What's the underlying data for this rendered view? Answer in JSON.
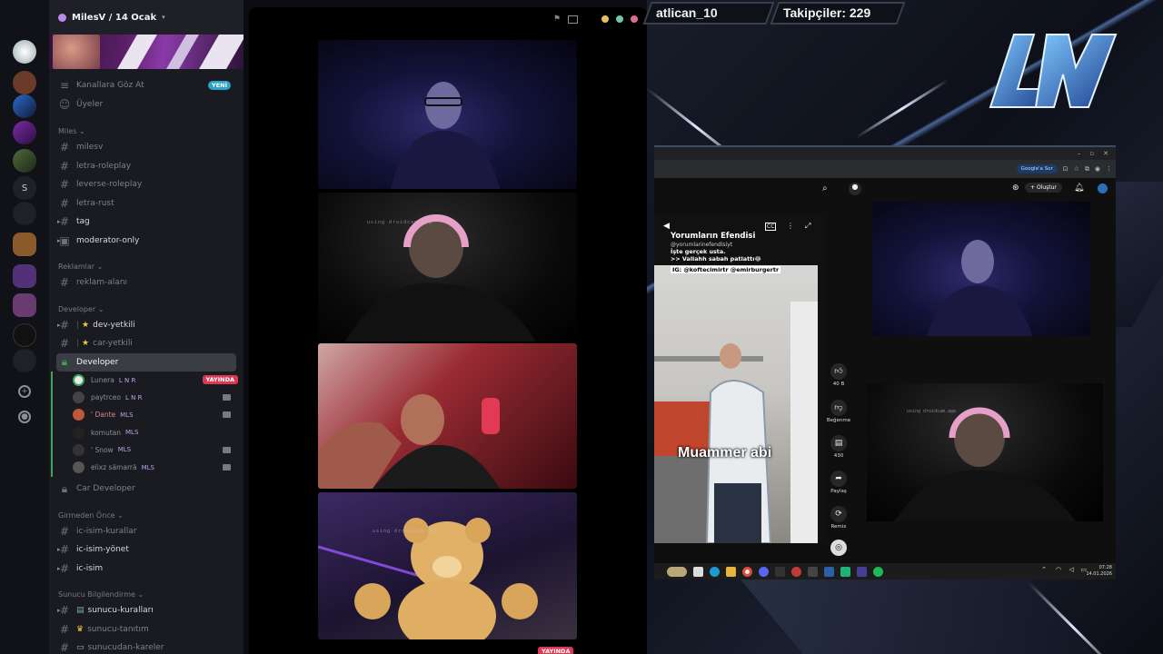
{
  "server": {
    "title": "MilesV / 14 Ocak"
  },
  "top_links": [
    {
      "label": "Kanallara Göz At",
      "badge": "YENİ"
    },
    {
      "label": "Üyeler"
    }
  ],
  "categories": {
    "miles": "Miles",
    "reklamlar": "Reklamlar",
    "developer": "Developer",
    "girmeden": "Girmeden Önce",
    "sunucu": "Sunucu Bilgilendirme"
  },
  "channels": {
    "miles": [
      "milesv",
      "letra-roleplay",
      "leverse-roleplay",
      "letra-rust",
      "tag",
      "moderator-only"
    ],
    "reklam": [
      "reklam-alanı"
    ],
    "developer": [
      "dev-yetkili",
      "car-yetkili"
    ],
    "voice_developer": "Developer",
    "car_developer": "Car Developer",
    "girmeden": [
      "ic-isim-kurallar",
      "ic-isim-yönet",
      "ic-isim"
    ],
    "sunucu": [
      "sunucu-kuralları",
      "sunucu-tanıtım",
      "sunucudan-kareler"
    ]
  },
  "voice_users": [
    {
      "name": "Lunera",
      "tag": "L N R",
      "live": "YAYINDA"
    },
    {
      "name": "paytrceo",
      "tag": "L N R"
    },
    {
      "name": "' Dante",
      "tag": "MLS"
    },
    {
      "name": "komutan",
      "tag": "MLS"
    },
    {
      "name": "' Snow",
      "tag": "MLS"
    },
    {
      "name": "elixz sämarrä",
      "tag": "MLS"
    }
  ],
  "stream": {
    "live_badge": "YAYINDA",
    "overlay_watermark": "using droidcam.app"
  },
  "overlay": {
    "username": "atlican_10",
    "followers": "Takipçiler: 229",
    "logo_text": "LN"
  },
  "youtube": {
    "google_btn": "Google'a Sor",
    "create": "Oluştur",
    "channel_title": "Yorumların Efendisi",
    "channel_handle": "@yorumlarinefendisiyt",
    "line1": "İşte gerçek usta.",
    "line2": ">> Vallahh sabah patlattı😂",
    "line3": "IG: @koftecimirtr @emirburgertr",
    "caption": "Muammer abi",
    "actions": [
      {
        "icon": "like",
        "label": "40 B"
      },
      {
        "icon": "dislike",
        "label": "Beğenme"
      },
      {
        "icon": "comment",
        "label": "430"
      },
      {
        "icon": "share",
        "label": "Paylaş"
      },
      {
        "icon": "remix",
        "label": "Remix"
      }
    ]
  },
  "clock": {
    "time": "07:28",
    "date": "14.01.2026"
  },
  "colors": {
    "accent": "#5865f2",
    "live": "#d83a53",
    "online": "#3ba55d",
    "new_badge": "#29a3c9"
  }
}
